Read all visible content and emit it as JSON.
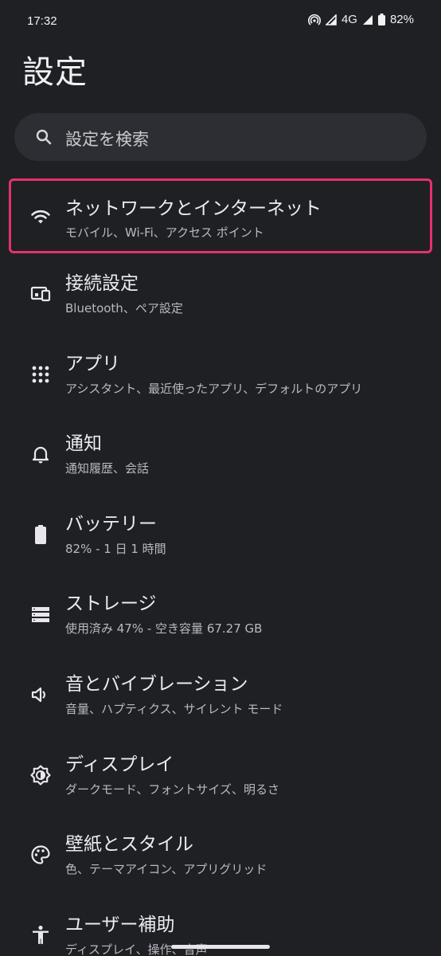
{
  "status_bar": {
    "time": "17:32",
    "network": "4G",
    "battery": "82%"
  },
  "page": {
    "title": "設定"
  },
  "search": {
    "placeholder": "設定を検索"
  },
  "colors": {
    "background": "#1f2024",
    "search_bg": "#2d2e33",
    "highlight": "#e5316b"
  },
  "items": [
    {
      "title": "ネットワークとインターネット",
      "subtitle": "モバイル、Wi-Fi、アクセス ポイント",
      "icon": "wifi-icon"
    },
    {
      "title": "接続設定",
      "subtitle": "Bluetooth、ペア設定",
      "icon": "connected-devices-icon"
    },
    {
      "title": "アプリ",
      "subtitle": "アシスタント、最近使ったアプリ、デフォルトのアプリ",
      "icon": "apps-grid-icon"
    },
    {
      "title": "通知",
      "subtitle": "通知履歴、会話",
      "icon": "bell-icon"
    },
    {
      "title": "バッテリー",
      "subtitle": "82% - 1 日 1 時間",
      "icon": "battery-icon"
    },
    {
      "title": "ストレージ",
      "subtitle": "使用済み 47% - 空き容量 67.27 GB",
      "icon": "storage-icon"
    },
    {
      "title": "音とバイブレーション",
      "subtitle": "音量、ハプティクス、サイレント モード",
      "icon": "volume-icon"
    },
    {
      "title": "ディスプレイ",
      "subtitle": "ダークモード、フォントサイズ、明るさ",
      "icon": "brightness-icon"
    },
    {
      "title": "壁紙とスタイル",
      "subtitle": "色、テーマアイコン、アプリグリッド",
      "icon": "palette-icon"
    },
    {
      "title": "ユーザー補助",
      "subtitle": "ディスプレイ、操作、音声",
      "icon": "accessibility-icon"
    }
  ]
}
